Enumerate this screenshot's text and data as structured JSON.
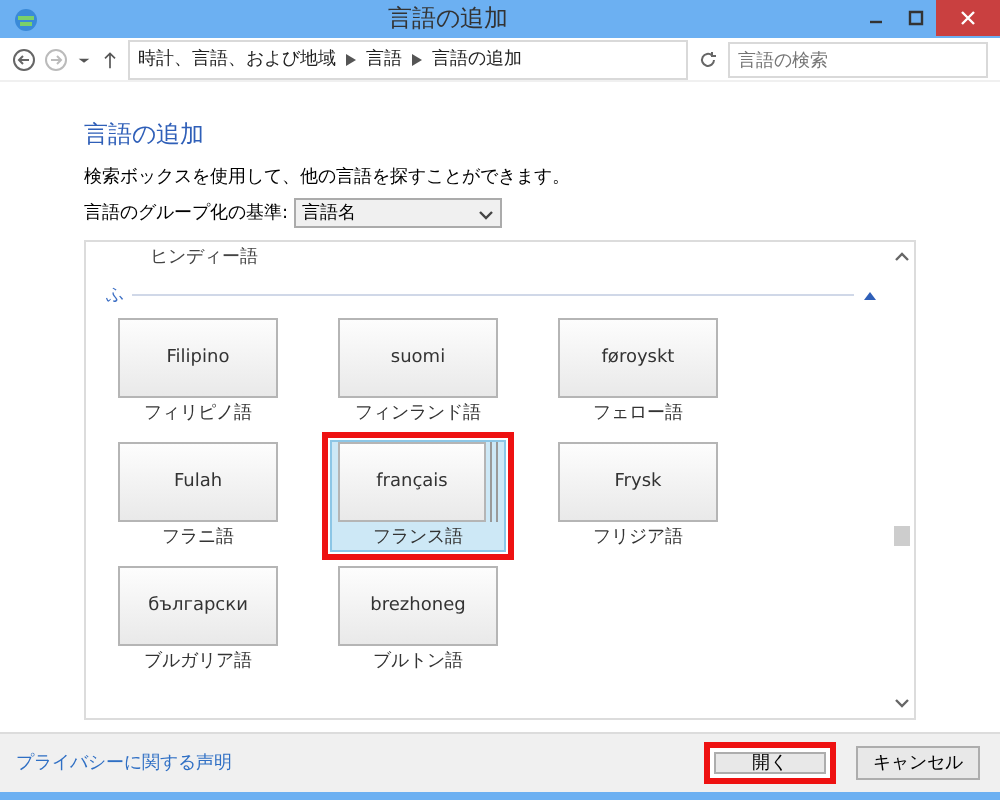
{
  "window": {
    "title": "言語の追加"
  },
  "address_bar": {
    "path": [
      "時計、言語、および地域",
      "言語",
      "言語の追加"
    ]
  },
  "search": {
    "placeholder": "言語の検索"
  },
  "heading": "言語の追加",
  "description": "検索ボックスを使用して、他の言語を探すことができます。",
  "grouping": {
    "label": "言語のグループ化の基準:",
    "value": "言語名"
  },
  "list": {
    "top_label": "ヒンディー語",
    "section": {
      "label": "ふ",
      "expanded": true
    },
    "rows": [
      [
        {
          "name": "Filipino",
          "caption": "フィリピノ語",
          "selected": false,
          "stacked": false,
          "annotated": false
        },
        {
          "name": "suomi",
          "caption": "フィンランド語",
          "selected": false,
          "stacked": false,
          "annotated": false
        },
        {
          "name": "føroyskt",
          "caption": "フェロー語",
          "selected": false,
          "stacked": false,
          "annotated": false
        }
      ],
      [
        {
          "name": "Fulah",
          "caption": "フラニ語",
          "selected": false,
          "stacked": false,
          "annotated": false
        },
        {
          "name": "français",
          "caption": "フランス語",
          "selected": true,
          "stacked": true,
          "annotated": true
        },
        {
          "name": "Frysk",
          "caption": "フリジア語",
          "selected": false,
          "stacked": false,
          "annotated": false
        }
      ],
      [
        {
          "name": "български",
          "caption": "ブルガリア語",
          "selected": false,
          "stacked": false,
          "annotated": false
        },
        {
          "name": "brezhoneg",
          "caption": "ブルトン語",
          "selected": false,
          "stacked": false,
          "annotated": false
        }
      ]
    ]
  },
  "footer": {
    "privacy_link": "プライバシーに関する声明",
    "buttons": [
      {
        "label": "開く",
        "annotated": true
      },
      {
        "label": "キャンセル",
        "annotated": false
      }
    ]
  }
}
